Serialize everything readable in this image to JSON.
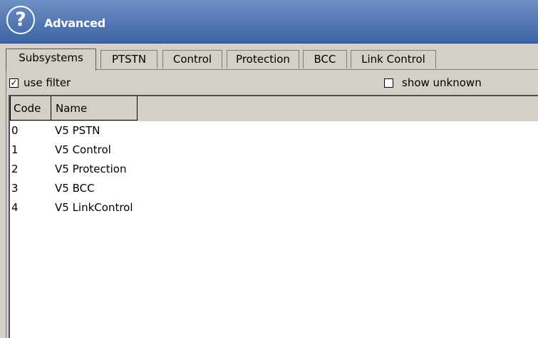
{
  "window": {
    "title": "Advanced",
    "icon": "help-icon"
  },
  "tabs": [
    "Subsystems",
    "PTSTN",
    "Control",
    "Protection",
    "BCC",
    "Link Control"
  ],
  "filters": {
    "use_filter": {
      "label": "use filter",
      "checked": true
    },
    "show_unknown": {
      "label": "show unknown",
      "checked": false
    }
  },
  "table": {
    "columns": [
      "Code",
      "Name"
    ],
    "rows": [
      {
        "code": "0",
        "name": "V5 PSTN"
      },
      {
        "code": "1",
        "name": "V5 Control"
      },
      {
        "code": "2",
        "name": "V5 Protection"
      },
      {
        "code": "3",
        "name": "V5 BCC"
      },
      {
        "code": "4",
        "name": "V5 LinkControl"
      }
    ]
  }
}
